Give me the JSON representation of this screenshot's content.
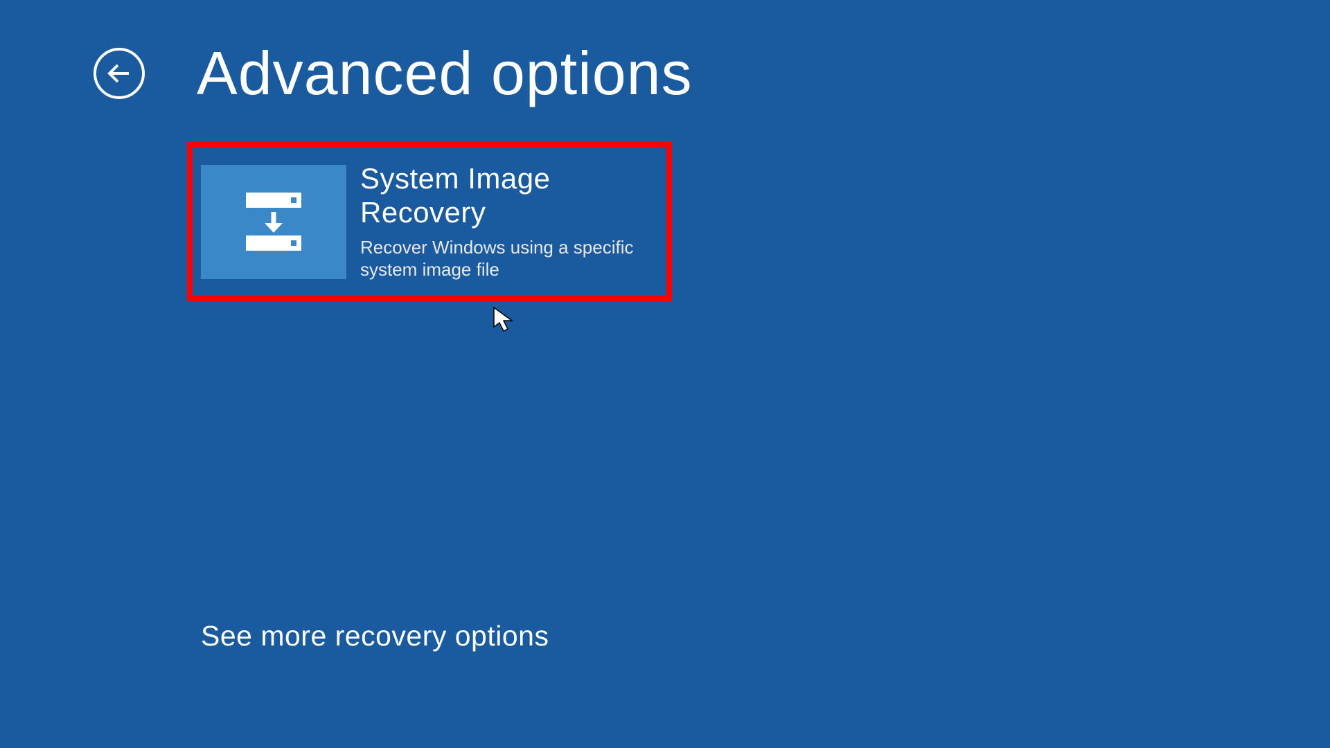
{
  "header": {
    "title": "Advanced options"
  },
  "tiles": [
    {
      "title": "System Image Recovery",
      "description": "Recover Windows using a specific system image file",
      "highlighted": true
    }
  ],
  "footer": {
    "more_options_label": "See more recovery options"
  },
  "colors": {
    "background": "#1a5a9e",
    "tile_icon_bg": "#3a88c8",
    "highlight_border": "#ff0000",
    "text": "#ffffff"
  }
}
